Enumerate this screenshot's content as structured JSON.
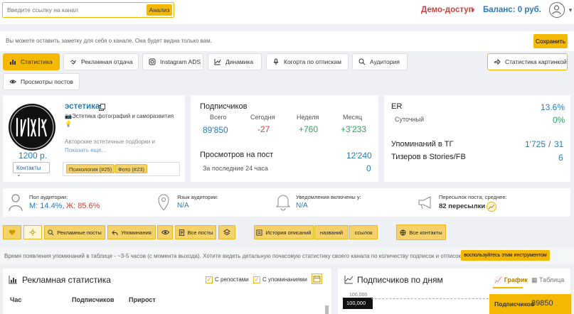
{
  "header": {
    "search_placeholder": "Введите ссылку на канал",
    "analyze_label": "Анализ",
    "demo_label": "Демо-доступ",
    "balance_label": "Баланс: 0 руб."
  },
  "note": {
    "placeholder": "Вы можете оставить заметку для себя о канале. Она будет видна только вам.",
    "save_label": "Сохранить"
  },
  "tabs": [
    {
      "label": "Статистика"
    },
    {
      "label": "Рекламная отдача"
    },
    {
      "label": "Instagram ADS"
    },
    {
      "label": "Динамика"
    },
    {
      "label": "Когорта по отпискам"
    },
    {
      "label": "Аудитория"
    },
    {
      "label": "Статистика картинкой"
    },
    {
      "label": "Просмотры постов"
    }
  ],
  "channel": {
    "name": "эстетика",
    "description": "📷Эстетика фотографий и саморазвития 💡",
    "description_more": "Авторские эстетичные подборки и",
    "show_more": "Показать еще...",
    "price": "1200 р.",
    "contacts_label": "Контакты",
    "tags": [
      "Психология (#25)",
      "Фото (#23)"
    ]
  },
  "subscribers": {
    "title": "Подписчиков",
    "cols": [
      {
        "label": "Всего",
        "value": "89'850",
        "color": "#2a7ab8"
      },
      {
        "label": "Сегодня",
        "value": "-27",
        "color": "#d0403a"
      },
      {
        "label": "Неделя",
        "value": "+760",
        "color": "#2aa35a"
      },
      {
        "label": "Месяц",
        "value": "+3'233",
        "color": "#2aa35a"
      }
    ],
    "views_title": "Просмотров на пост",
    "views_value": "12'240",
    "last24_label": "За последние 24 часа",
    "last24_value": "0"
  },
  "er": {
    "er_label": "ER",
    "er_value": "13.6%",
    "daily_label": "Суточный",
    "daily_value": "0%",
    "mentions_label": "Упоминаний в ТГ",
    "mentions_value": "1'725",
    "mentions_value2": "31",
    "teasers_label": "Тизеров в Stories/FB",
    "teasers_value": "6"
  },
  "audience": {
    "gender_label": "Пол аудитории:",
    "male": "М: 14.4%,",
    "female": "Ж: 85.6%",
    "lang_label": "Язык аудитории:",
    "lang_value": "N/A",
    "notif_label": "Уведомления включены у:",
    "notif_value": "N/A",
    "reposts_label": "Пересылок поста, среднее:",
    "reposts_value": "82 пересылки"
  },
  "actions": {
    "ad_posts": "Рекламные посты",
    "mentions": "Упоминания",
    "all_posts": "Все посты",
    "history": "История описаний",
    "names": "названий",
    "links": "ссылок",
    "all_contacts": "Все контакты"
  },
  "info": {
    "text": "Время появления упоминаний в таблице - ~3-5 часов (с момента выхода). Хотите видеть детальную почасовую статистику своего канала по количеству подписок и отписок?",
    "button": "воспользуйтесь этим инструментом"
  },
  "ad_stats": {
    "title": "Рекламная статистика",
    "with_reposts": "С репостами",
    "with_mentions": "С упоминаниями",
    "col_hour": "Час",
    "col_subs": "Подписчиков",
    "col_growth": "Прирост"
  },
  "subs_by_day": {
    "title": "Подписчиков по дням",
    "tab_chart": "График",
    "tab_table": "Таблица",
    "axis_tick": "100,000",
    "tooltip_label": "Подписчиков",
    "tooltip_value": "89850"
  }
}
